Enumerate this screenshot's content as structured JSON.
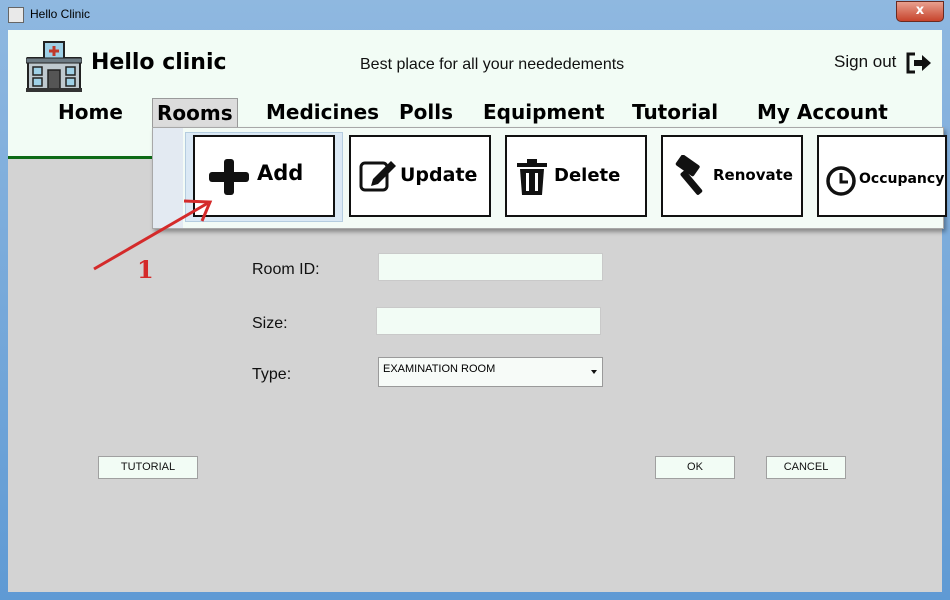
{
  "window": {
    "title": "Hello Clinic",
    "close_glyph": "x"
  },
  "header": {
    "brand": "Hello clinic",
    "tagline": "Best place for all your neededements",
    "sign_out": "Sign out",
    "logo_icon": "hospital-building-icon",
    "sign_out_icon": "sign-out-icon"
  },
  "nav": {
    "items": [
      "Home",
      "Rooms",
      "Medicines",
      "Polls",
      "Equipment",
      "Tutorial",
      "My Account"
    ],
    "active": "Rooms"
  },
  "rooms_menu": {
    "items": [
      {
        "label": "Add",
        "icon": "plus-icon"
      },
      {
        "label": "Update",
        "icon": "edit-icon"
      },
      {
        "label": "Delete",
        "icon": "trash-icon"
      },
      {
        "label": "Renovate",
        "icon": "hammer-icon"
      },
      {
        "label": "Occupancy",
        "icon": "clock-icon"
      }
    ]
  },
  "form": {
    "room_id_label": "Room ID:",
    "room_id_value": "",
    "size_label": "Size:",
    "size_value": "",
    "type_label": "Type:",
    "type_value": "EXAMINATION ROOM"
  },
  "buttons": {
    "tutorial": "TUTORIAL",
    "ok": "OK",
    "cancel": "CANCEL"
  },
  "annotation": {
    "number": "1",
    "color": "#d42a2a"
  },
  "colors": {
    "header_bg": "#f2fcf5",
    "header_border": "#0d6a16",
    "content_bg": "#d3d3d3"
  }
}
